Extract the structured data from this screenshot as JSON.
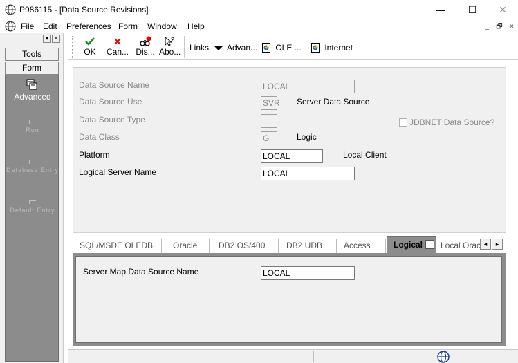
{
  "window": {
    "title": "P986115 - [Data Source Revisions]",
    "minimize": "—",
    "maximize": "☐",
    "close": "✕"
  },
  "menu": {
    "items": [
      "File",
      "Edit",
      "Preferences",
      "Form",
      "Window",
      "Help"
    ],
    "mdi_controls": [
      "_",
      "🗗",
      "×"
    ]
  },
  "left_panel": {
    "tools_label": "Tools",
    "form_label": "Form",
    "advanced_label": "Advanced",
    "faint_items": [
      "Run",
      "Database Entry",
      "Default Entry"
    ]
  },
  "toolbar": {
    "ok": "OK",
    "cancel": "Can...",
    "display": "Dis...",
    "about": "Abo...",
    "links": "Links",
    "advanced": "Advan...",
    "ole": "OLE ...",
    "internet": "Internet"
  },
  "form": {
    "data_source_name_label": "Data Source Name",
    "data_source_name_value": "LOCAL",
    "data_source_use_label": "Data Source Use",
    "data_source_use_value": "SVR",
    "data_source_use_desc": "Server Data Source",
    "data_source_type_label": "Data Source Type",
    "data_source_type_value": "",
    "data_class_label": "Data Class",
    "data_class_value": "G",
    "data_class_desc": "Logic",
    "jdbnet_label": "JDBNET Data Source?",
    "platform_label": "Platform",
    "platform_value": "LOCAL",
    "platform_desc": "Local Client",
    "logical_server_label": "Logical Server Name",
    "logical_server_value": "LOCAL"
  },
  "tabs": {
    "items": [
      "SQL/MSDE OLEDB",
      "Oracle",
      "DB2 OS/400",
      "DB2 UDB",
      "Access",
      "Logical",
      "Local Orac"
    ],
    "active": "Logical",
    "prev": "◂",
    "next": "▸"
  },
  "tab_panel": {
    "server_map_label": "Server Map Data Source Name",
    "server_map_value": "LOCAL"
  },
  "colors": {
    "panel_gray": "#8c8c8c",
    "form_bg": "#f0f0f0",
    "ok_green": "#1a8a1a",
    "cancel_red": "#d01010"
  }
}
